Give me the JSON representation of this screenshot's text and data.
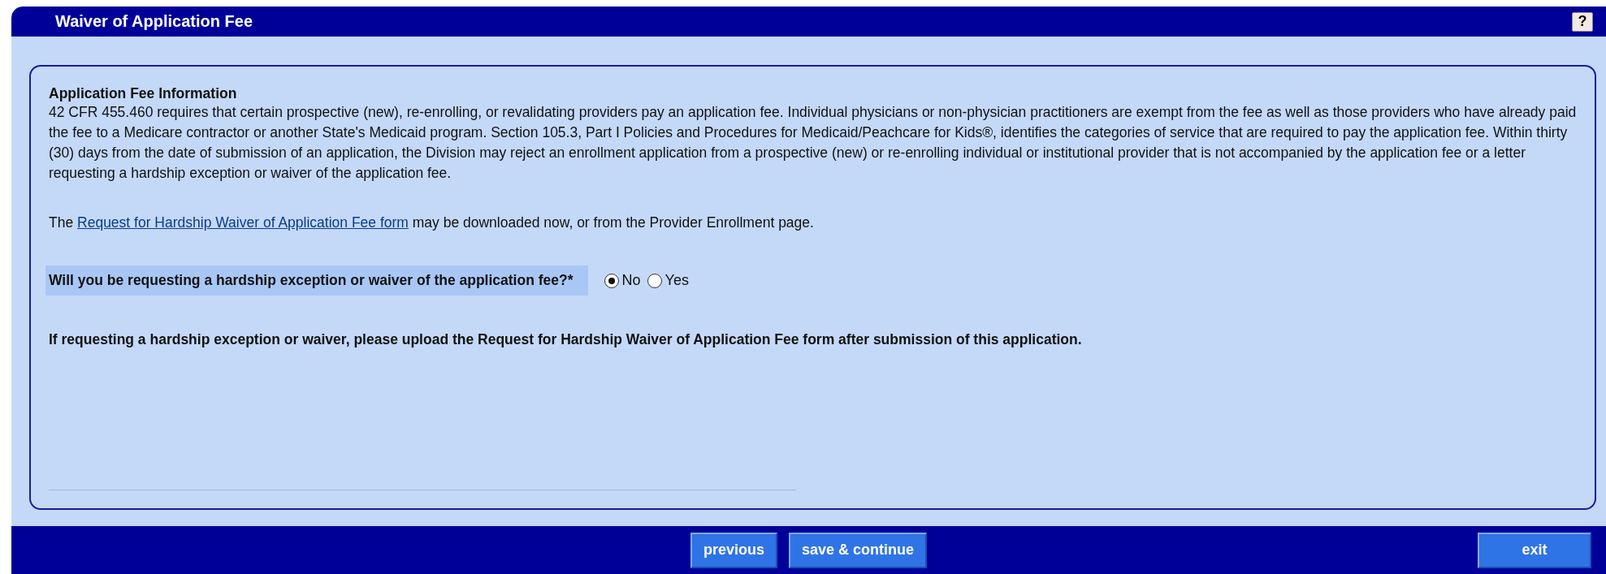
{
  "window": {
    "title": "Waiver of Application Fee",
    "help_button": "?"
  },
  "section": {
    "heading": "Application Fee Information",
    "body": "42 CFR 455.460 requires that certain prospective (new), re-enrolling, or revalidating providers pay an application fee. Individual physicians or non-physician practitioners are exempt from the fee as well as those providers who have already paid the fee to a Medicare contractor or another State's Medicaid program. Section 105.3, Part I Policies and Procedures for Medicaid/Peachcare for Kids®, identifies the categories of service that are required to pay the application fee. Within thirty (30) days from the date of submission of an application, the Division may reject an enrollment application from a prospective (new) or re-enrolling individual or institutional provider that is not accompanied by the application fee or a letter requesting a hardship exception or waiver of the application fee."
  },
  "download_note": {
    "before": "The",
    "link": "Request for Hardship Waiver of Application Fee form",
    "after": "may be downloaded now, or from the Provider Enrollment page."
  },
  "question": {
    "label": "Will you be requesting a hardship exception or waiver of the application fee?*",
    "options": [
      {
        "label": "No",
        "selected": true
      },
      {
        "label": "Yes",
        "selected": false
      }
    ]
  },
  "instruction": "If requesting a hardship exception or waiver, please upload the Request for Hardship Waiver of Application Fee form after submission of this application.",
  "nav_buttons": [
    {
      "label": "previous"
    },
    {
      "label": "save & continue"
    }
  ],
  "exit_button": "exit"
}
